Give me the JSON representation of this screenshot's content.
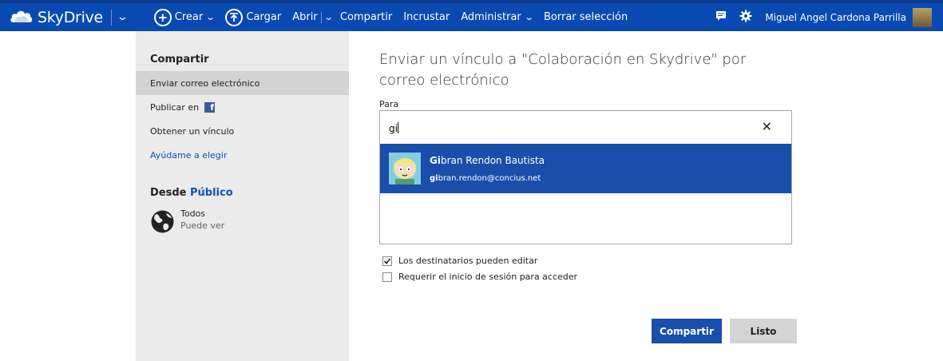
{
  "topbar": {
    "brand": "SkyDrive",
    "commands": {
      "crear": "Crear",
      "cargar": "Cargar",
      "abrir": "Abrir",
      "compartir": "Compartir",
      "incrustar": "Incrustar",
      "administrar": "Administrar",
      "borrar": "Borrar selección"
    },
    "user_name": "Miguel Angel Cardona Parrilla",
    "icons": [
      "skydrive-cloud-icon",
      "plus-circle-icon",
      "upload-circle-icon",
      "chevron-down-icon",
      "chat-icon",
      "gear-icon"
    ]
  },
  "sidebar": {
    "heading": "Compartir",
    "items": [
      {
        "label": "Enviar correo electrónico",
        "selected": true
      },
      {
        "label": "Publicar en"
      },
      {
        "label": "Obtener un vínculo"
      },
      {
        "label": "Ayúdame a elegir",
        "link": true
      }
    ],
    "facebook_letter": "f",
    "from_label": "Desde",
    "from_value": "Público",
    "audience_title": "Todos",
    "audience_sub": "Puede ver"
  },
  "dialog": {
    "title": "Enviar un vínculo a \"Colaboración en Skydrive\" por correo electrónico",
    "to_label": "Para",
    "to_value": "gi",
    "clear_symbol": "✕",
    "suggestion": {
      "name_match": "Gi",
      "name_rest": "bran Rendon Bautista",
      "email_match": "gi",
      "email_rest": "bran.rendon@concius.net"
    },
    "option_edit": "Los destinatarios pueden editar",
    "option_edit_checked": true,
    "option_signin": "Requerir el inicio de sesión para acceder",
    "option_signin_checked": false,
    "share_button": "Compartir",
    "done_button": "Listo"
  },
  "colors": {
    "topbar": "#094ab2",
    "selection": "#1a4eab",
    "sidebar_bg": "#ebebeb",
    "link": "#0a55b8"
  }
}
